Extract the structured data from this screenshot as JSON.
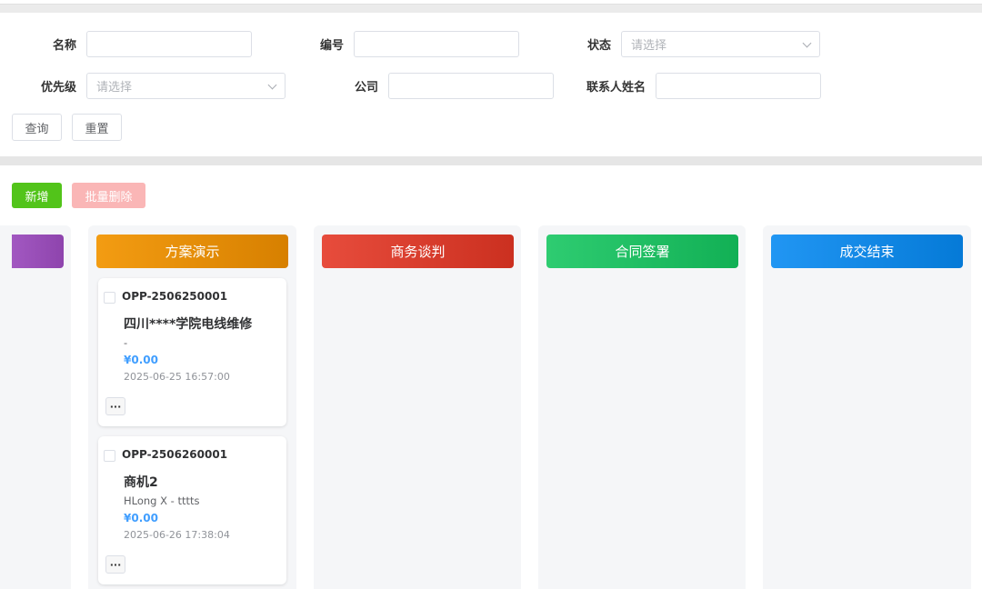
{
  "filters": {
    "name_label": "名称",
    "code_label": "编号",
    "status_label": "状态",
    "status_placeholder": "请选择",
    "priority_label": "优先级",
    "priority_placeholder": "请选择",
    "company_label": "公司",
    "contact_label": "联系人姓名",
    "query_button": "查询",
    "reset_button": "重置"
  },
  "toolbar": {
    "add_button": "新增",
    "batch_delete_button": "批量删除"
  },
  "columns": [
    {
      "title": "方案演示",
      "color": "#f39c12"
    },
    {
      "title": "商务谈判",
      "color": "#e74c3c"
    },
    {
      "title": "合同签署",
      "color": "#2ecc71"
    },
    {
      "title": "成交结束",
      "color": "#2196f3"
    }
  ],
  "partial_column_color": "#8e44ad",
  "cards": [
    {
      "code": "OPP-2506250001",
      "title": "四川****学院电线维修",
      "subtitle": "-",
      "amount": "¥0.00",
      "time": "2025-06-25 16:57:00",
      "more": "···"
    },
    {
      "code": "OPP-2506260001",
      "title": "商机2",
      "subtitle": "HLong X - tttts",
      "amount": "¥0.00",
      "time": "2025-06-26 17:38:04",
      "more": "···"
    }
  ]
}
